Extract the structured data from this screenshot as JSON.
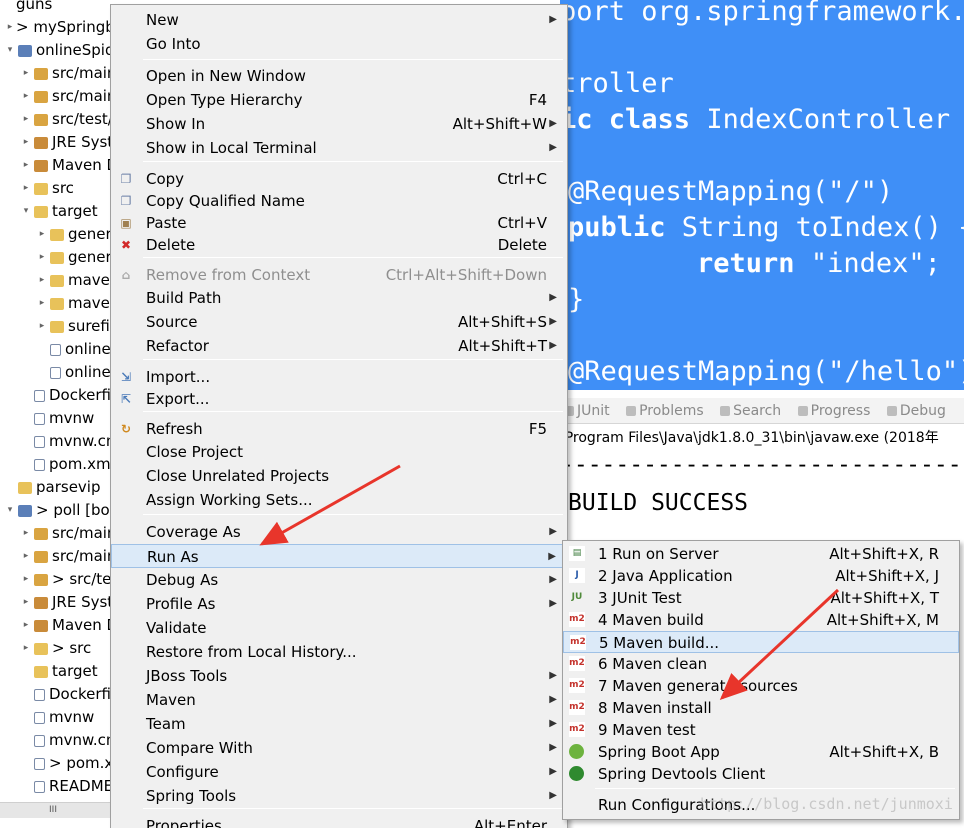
{
  "explorer": {
    "items": [
      {
        "label": "guns",
        "indent": 0,
        "twisty": "",
        "icon": "none"
      },
      {
        "label": "> mySpringbo",
        "indent": 0,
        "twisty": "▸",
        "icon": "none"
      },
      {
        "label": "onlineSpide",
        "indent": 0,
        "twisty": "▾",
        "icon": "proj"
      },
      {
        "label": "src/main/",
        "indent": 1,
        "twisty": "▸",
        "icon": "pkg"
      },
      {
        "label": "src/main/",
        "indent": 1,
        "twisty": "▸",
        "icon": "pkg"
      },
      {
        "label": "src/test/j",
        "indent": 1,
        "twisty": "▸",
        "icon": "pkg"
      },
      {
        "label": "JRE Syste",
        "indent": 1,
        "twisty": "▸",
        "icon": "lib"
      },
      {
        "label": "Maven D",
        "indent": 1,
        "twisty": "▸",
        "icon": "lib"
      },
      {
        "label": "src",
        "indent": 1,
        "twisty": "▸",
        "icon": "fold"
      },
      {
        "label": "target",
        "indent": 1,
        "twisty": "▾",
        "icon": "fold"
      },
      {
        "label": "genera",
        "indent": 2,
        "twisty": "▸",
        "icon": "fold"
      },
      {
        "label": "genera",
        "indent": 2,
        "twisty": "▸",
        "icon": "fold"
      },
      {
        "label": "maven",
        "indent": 2,
        "twisty": "▸",
        "icon": "fold"
      },
      {
        "label": "maven",
        "indent": 2,
        "twisty": "▸",
        "icon": "fold"
      },
      {
        "label": "surefir",
        "indent": 2,
        "twisty": "▸",
        "icon": "fold"
      },
      {
        "label": "online",
        "indent": 2,
        "twisty": "",
        "icon": "file"
      },
      {
        "label": "online",
        "indent": 2,
        "twisty": "",
        "icon": "file"
      },
      {
        "label": "Dockerfil",
        "indent": 1,
        "twisty": "",
        "icon": "file"
      },
      {
        "label": "mvnw",
        "indent": 1,
        "twisty": "",
        "icon": "file"
      },
      {
        "label": "mvnw.cm",
        "indent": 1,
        "twisty": "",
        "icon": "file"
      },
      {
        "label": "pom.xml",
        "indent": 1,
        "twisty": "",
        "icon": "file"
      },
      {
        "label": "parsevip",
        "indent": 0,
        "twisty": "",
        "icon": "fold"
      },
      {
        "label": "> poll [boot",
        "indent": 0,
        "twisty": "▾",
        "icon": "proj"
      },
      {
        "label": "src/main/",
        "indent": 1,
        "twisty": "▸",
        "icon": "pkg"
      },
      {
        "label": "src/main/",
        "indent": 1,
        "twisty": "▸",
        "icon": "pkg"
      },
      {
        "label": "> src/tes",
        "indent": 1,
        "twisty": "▸",
        "icon": "pkg"
      },
      {
        "label": "JRE Syste",
        "indent": 1,
        "twisty": "▸",
        "icon": "lib"
      },
      {
        "label": "Maven D",
        "indent": 1,
        "twisty": "▸",
        "icon": "lib"
      },
      {
        "label": "> src",
        "indent": 1,
        "twisty": "▸",
        "icon": "fold"
      },
      {
        "label": "target",
        "indent": 1,
        "twisty": "",
        "icon": "fold"
      },
      {
        "label": "Dockerfil",
        "indent": 1,
        "twisty": "",
        "icon": "file"
      },
      {
        "label": "mvnw",
        "indent": 1,
        "twisty": "",
        "icon": "file"
      },
      {
        "label": "mvnw.cm",
        "indent": 1,
        "twisty": "",
        "icon": "file"
      },
      {
        "label": "> pom.xn",
        "indent": 1,
        "twisty": "",
        "icon": "file"
      },
      {
        "label": "README.",
        "indent": 1,
        "twisty": "",
        "icon": "file"
      }
    ],
    "scroll_thumb": "III"
  },
  "editor": {
    "lines": [
      {
        "text": "port org.springframework.st",
        "bold": false
      },
      {
        "text": "",
        "bold": false
      },
      {
        "text": "troller",
        "bold": false
      },
      {
        "text": "ic class IndexController",
        "bold": false
      },
      {
        "text": "",
        "bold": false
      },
      {
        "text": "@RequestMapping(\"/\")",
        "bold": false
      },
      {
        "text": "public String toIndex() {",
        "bold": false
      },
      {
        "text": "    return \"index\";",
        "bold": false
      },
      {
        "text": "}",
        "bold": false
      },
      {
        "text": "",
        "bold": false
      },
      {
        "text": "@RequestMapping(\"/hello\")",
        "bold": false
      }
    ]
  },
  "views": {
    "tabs": [
      "JUnit",
      "Problems",
      "Search",
      "Progress",
      "Debug"
    ],
    "console_path": "\\Program Files\\Java\\jdk1.8.0_31\\bin\\javaw.exe (2018年",
    "dashes": "------------------------------",
    "build_result": "BUILD SUCCESS"
  },
  "context_menu": {
    "items": [
      {
        "label": "New",
        "accel": "",
        "submenu": true,
        "icon": "",
        "disabled": false,
        "sep_before": false
      },
      {
        "label": "Go Into",
        "accel": "",
        "submenu": false,
        "icon": "",
        "disabled": false,
        "sep_before": false
      },
      {
        "label": "Open in New Window",
        "accel": "",
        "submenu": false,
        "icon": "",
        "disabled": false,
        "sep_before": true
      },
      {
        "label": "Open Type Hierarchy",
        "accel": "F4",
        "submenu": false,
        "icon": "",
        "disabled": false,
        "sep_before": false
      },
      {
        "label": "Show In",
        "accel": "Alt+Shift+W",
        "submenu": true,
        "icon": "",
        "disabled": false,
        "sep_before": false
      },
      {
        "label": "Show in Local Terminal",
        "accel": "",
        "submenu": true,
        "icon": "",
        "disabled": false,
        "sep_before": false
      },
      {
        "label": "Copy",
        "accel": "Ctrl+C",
        "submenu": false,
        "icon": "copy-icon",
        "disabled": false,
        "sep_before": true
      },
      {
        "label": "Copy Qualified Name",
        "accel": "",
        "submenu": false,
        "icon": "copy-qualified-icon",
        "disabled": false,
        "sep_before": false
      },
      {
        "label": "Paste",
        "accel": "Ctrl+V",
        "submenu": false,
        "icon": "paste-icon",
        "disabled": false,
        "sep_before": false
      },
      {
        "label": "Delete",
        "accel": "Delete",
        "submenu": false,
        "icon": "delete-icon",
        "disabled": false,
        "sep_before": false
      },
      {
        "label": "Remove from Context",
        "accel": "Ctrl+Alt+Shift+Down",
        "submenu": false,
        "icon": "remove-context-icon",
        "disabled": true,
        "sep_before": true
      },
      {
        "label": "Build Path",
        "accel": "",
        "submenu": true,
        "icon": "",
        "disabled": false,
        "sep_before": false
      },
      {
        "label": "Source",
        "accel": "Alt+Shift+S",
        "submenu": true,
        "icon": "",
        "disabled": false,
        "sep_before": false
      },
      {
        "label": "Refactor",
        "accel": "Alt+Shift+T",
        "submenu": true,
        "icon": "",
        "disabled": false,
        "sep_before": false
      },
      {
        "label": "Import...",
        "accel": "",
        "submenu": false,
        "icon": "import-icon",
        "disabled": false,
        "sep_before": true
      },
      {
        "label": "Export...",
        "accel": "",
        "submenu": false,
        "icon": "export-icon",
        "disabled": false,
        "sep_before": false
      },
      {
        "label": "Refresh",
        "accel": "F5",
        "submenu": false,
        "icon": "refresh-icon",
        "disabled": false,
        "sep_before": true
      },
      {
        "label": "Close Project",
        "accel": "",
        "submenu": false,
        "icon": "",
        "disabled": false,
        "sep_before": false
      },
      {
        "label": "Close Unrelated Projects",
        "accel": "",
        "submenu": false,
        "icon": "",
        "disabled": false,
        "sep_before": false
      },
      {
        "label": "Assign Working Sets...",
        "accel": "",
        "submenu": false,
        "icon": "",
        "disabled": false,
        "sep_before": false
      },
      {
        "label": "Coverage As",
        "accel": "",
        "submenu": true,
        "icon": "",
        "disabled": false,
        "sep_before": true
      },
      {
        "label": "Run As",
        "accel": "",
        "submenu": true,
        "icon": "",
        "disabled": false,
        "sep_before": false,
        "highlight": true
      },
      {
        "label": "Debug As",
        "accel": "",
        "submenu": true,
        "icon": "",
        "disabled": false,
        "sep_before": false
      },
      {
        "label": "Profile As",
        "accel": "",
        "submenu": true,
        "icon": "",
        "disabled": false,
        "sep_before": false
      },
      {
        "label": "Validate",
        "accel": "",
        "submenu": false,
        "icon": "",
        "disabled": false,
        "sep_before": false
      },
      {
        "label": "Restore from Local History...",
        "accel": "",
        "submenu": false,
        "icon": "",
        "disabled": false,
        "sep_before": false
      },
      {
        "label": "JBoss Tools",
        "accel": "",
        "submenu": true,
        "icon": "",
        "disabled": false,
        "sep_before": false
      },
      {
        "label": "Maven",
        "accel": "",
        "submenu": true,
        "icon": "",
        "disabled": false,
        "sep_before": false
      },
      {
        "label": "Team",
        "accel": "",
        "submenu": true,
        "icon": "",
        "disabled": false,
        "sep_before": false
      },
      {
        "label": "Compare With",
        "accel": "",
        "submenu": true,
        "icon": "",
        "disabled": false,
        "sep_before": false
      },
      {
        "label": "Configure",
        "accel": "",
        "submenu": true,
        "icon": "",
        "disabled": false,
        "sep_before": false
      },
      {
        "label": "Spring Tools",
        "accel": "",
        "submenu": true,
        "icon": "",
        "disabled": false,
        "sep_before": false
      },
      {
        "label": "Properties",
        "accel": "Alt+Enter",
        "submenu": false,
        "icon": "",
        "disabled": false,
        "sep_before": true
      }
    ]
  },
  "run_as_submenu": {
    "items": [
      {
        "label": "1 Run on Server",
        "accel": "Alt+Shift+X, R",
        "icon": "server-icon",
        "glyph": "▤",
        "sep_before": false
      },
      {
        "label": "2 Java Application",
        "accel": "Alt+Shift+X, J",
        "icon": "java-app-icon",
        "glyph": "J",
        "sep_before": false
      },
      {
        "label": "3 JUnit Test",
        "accel": "Alt+Shift+X, T",
        "icon": "junit-icon",
        "glyph": "JU",
        "sep_before": false
      },
      {
        "label": "4 Maven build",
        "accel": "Alt+Shift+X, M",
        "icon": "maven-m2-icon",
        "glyph": "m2",
        "sep_before": false
      },
      {
        "label": "5 Maven build...",
        "accel": "",
        "icon": "maven-m2-icon",
        "glyph": "m2",
        "sep_before": false,
        "highlight": true
      },
      {
        "label": "6 Maven clean",
        "accel": "",
        "icon": "maven-m2-icon",
        "glyph": "m2",
        "sep_before": false
      },
      {
        "label": "7 Maven generate-sources",
        "accel": "",
        "icon": "maven-m2-icon",
        "glyph": "m2",
        "sep_before": false
      },
      {
        "label": "8 Maven install",
        "accel": "",
        "icon": "maven-m2-icon",
        "glyph": "m2",
        "sep_before": false
      },
      {
        "label": "9 Maven test",
        "accel": "",
        "icon": "maven-m2-icon",
        "glyph": "m2",
        "sep_before": false
      },
      {
        "label": "Spring Boot App",
        "accel": "Alt+Shift+X, B",
        "icon": "spring-boot-icon",
        "glyph": "",
        "sep_before": false
      },
      {
        "label": "Spring Devtools Client",
        "accel": "",
        "icon": "spring-devtools-icon",
        "glyph": "",
        "sep_before": false
      },
      {
        "label": "Run Configurations...",
        "accel": "",
        "icon": "",
        "glyph": "",
        "sep_before": true
      }
    ]
  },
  "watermark": "http://blog.csdn.net/junmoxi",
  "colors": {
    "editor_bg": "#3f8ff7",
    "menu_bg": "#f0f0f0",
    "highlight": "#dceaf8",
    "arrow": "#e8352b",
    "maven_red": "#c4322c"
  }
}
